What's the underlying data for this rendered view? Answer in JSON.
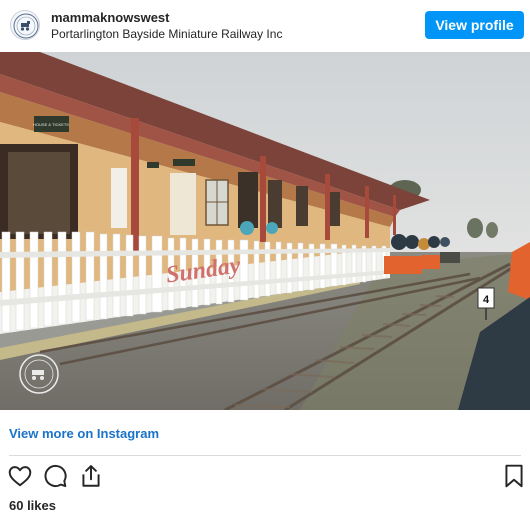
{
  "post": {
    "username": "mammaknowswest",
    "location": "Portarlington Bayside Miniature Railway Inc",
    "view_profile_label": "View profile",
    "view_more_label": "View more on Instagram",
    "likes": "60 likes"
  },
  "photo": {
    "fence_sign": "Sunday",
    "station_sign_1": "HOUSE & TICKETS",
    "track_marker": "4"
  },
  "icons": {
    "avatar": "railway-logo-icon",
    "like": "heart-icon",
    "comment": "comment-icon",
    "share": "share-icon",
    "save": "bookmark-icon"
  },
  "colors": {
    "accent": "#0095f6",
    "link": "#1a73c8"
  }
}
